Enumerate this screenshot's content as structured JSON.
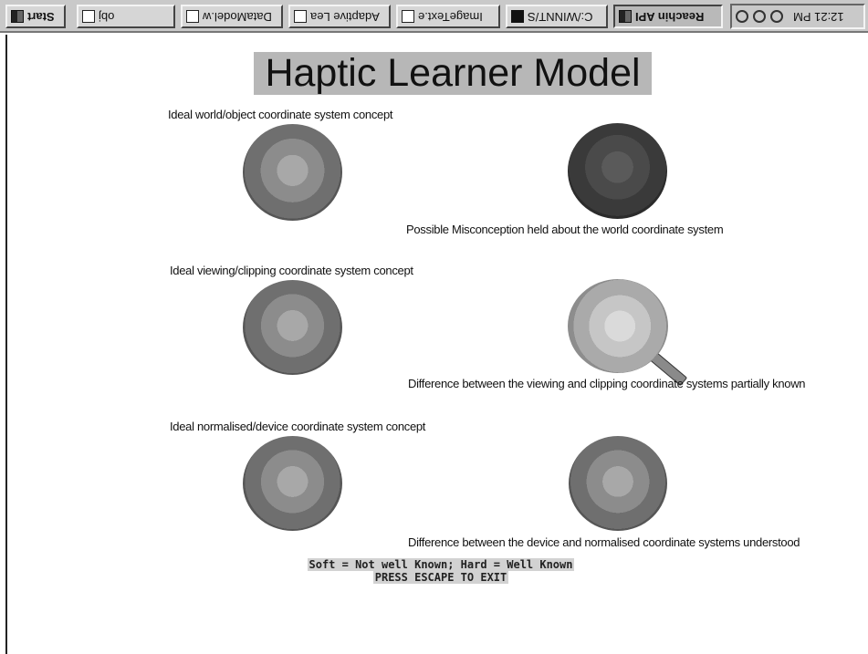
{
  "taskbar": {
    "buttons": [
      {
        "label": "Start",
        "icon": "windows-logo-icon"
      },
      {
        "label": "obj",
        "icon": "folder-icon"
      },
      {
        "label": "DataModel.w",
        "icon": "document-icon"
      },
      {
        "label": "Adaptive Lea",
        "icon": "browser-icon"
      },
      {
        "label": "ImageText.e",
        "icon": "image-icon"
      },
      {
        "label": "C:/WINNT/S",
        "icon": "console-icon"
      },
      {
        "label": "Reachin API",
        "icon": "app-icon"
      }
    ],
    "clock": "12:21 PM"
  },
  "title": "Haptic Learner Model",
  "rows": [
    {
      "ideal_caption": "Ideal world/object coordinate system concept",
      "learner_caption": "Possible Misconception held about the world coordinate system"
    },
    {
      "ideal_caption": "Ideal viewing/clipping coordinate system concept",
      "learner_caption": "Difference between the viewing and clipping coordinate systems partially known"
    },
    {
      "ideal_caption": "Ideal normalised/device coordinate system concept",
      "learner_caption": "Difference between the device and normalised coordinate systems understood"
    }
  ],
  "legend": {
    "line1": "Soft = Not well Known; Hard = Well Known",
    "line2": "PRESS ESCAPE TO EXIT"
  }
}
